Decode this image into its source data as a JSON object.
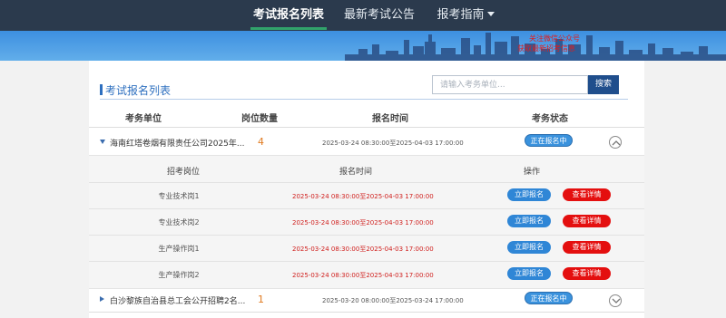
{
  "nav": {
    "items": [
      "考试报名列表",
      "最新考试公告",
      "报考指南"
    ],
    "active_index": 0
  },
  "banner": {
    "line1": "关注微信公众号",
    "line2": "获取最新招考信息"
  },
  "panel": {
    "title": "考试报名列表"
  },
  "search": {
    "placeholder": "请输入考务单位...",
    "button_label": "搜索"
  },
  "table": {
    "headers": [
      "考务单位",
      "岗位数量",
      "报名时间",
      "考务状态"
    ],
    "rows": [
      {
        "unit": "海南红塔卷烟有限责任公司2025年...",
        "count": "4",
        "time": "2025-03-24 08:30:00至2025-04-03 17:00:00",
        "status": "正在报名中",
        "expanded": true
      },
      {
        "unit": "白沙黎族自治县总工会公开招聘2名...",
        "count": "1",
        "time": "2025-03-20 08:00:00至2025-03-24 17:00:00",
        "status": "正在报名中",
        "expanded": false
      }
    ]
  },
  "subtable": {
    "headers": [
      "招考岗位",
      "报名时间",
      "操作"
    ],
    "apply_label": "立即报名",
    "detail_label": "查看详情",
    "rows": [
      {
        "post": "专业技术岗1",
        "time": "2025-03-24 08:30:00至2025-04-03 17:00:00"
      },
      {
        "post": "专业技术岗2",
        "time": "2025-03-24 08:30:00至2025-04-03 17:00:00"
      },
      {
        "post": "生产操作岗1",
        "time": "2025-03-24 08:30:00至2025-04-03 17:00:00"
      },
      {
        "post": "生产操作岗2",
        "time": "2025-03-24 08:30:00至2025-04-03 17:00:00"
      }
    ]
  },
  "colors": {
    "nav_bg": "#2b3a4d",
    "nav_active_underline": "#31a36b",
    "accent_blue": "#2d6fbf",
    "apply_button": "#2f86d6",
    "detail_button": "#e40f0f",
    "count_orange": "#e07a1f",
    "sub_time_red": "#d0201e"
  },
  "icons": {
    "expand_toggle": "chevron-up-circle-icon",
    "collapse_toggle": "chevron-down-circle-icon",
    "row_expanded": "triangle-down-icon",
    "row_collapsed": "triangle-right-icon",
    "nav_dropdown": "caret-down-icon"
  }
}
